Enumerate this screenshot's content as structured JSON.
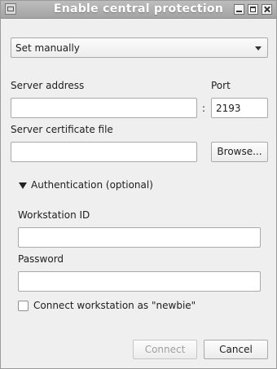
{
  "window": {
    "title": "Enable central protection"
  },
  "mode_select": {
    "value": "Set manually"
  },
  "server": {
    "address_label": "Server address",
    "address_value": "",
    "separator": ":",
    "port_label": "Port",
    "port_value": "2193",
    "cert_label": "Server certificate file",
    "cert_value": "",
    "browse_label": "Browse..."
  },
  "auth": {
    "toggle_label": "Authentication (optional)",
    "expanded": true,
    "workstation_id_label": "Workstation ID",
    "workstation_id_value": "",
    "password_label": "Password",
    "password_value": "",
    "newbie_label": "Connect workstation as \"newbie\"",
    "newbie_checked": false
  },
  "footer": {
    "connect_label": "Connect",
    "connect_enabled": false,
    "cancel_label": "Cancel"
  }
}
